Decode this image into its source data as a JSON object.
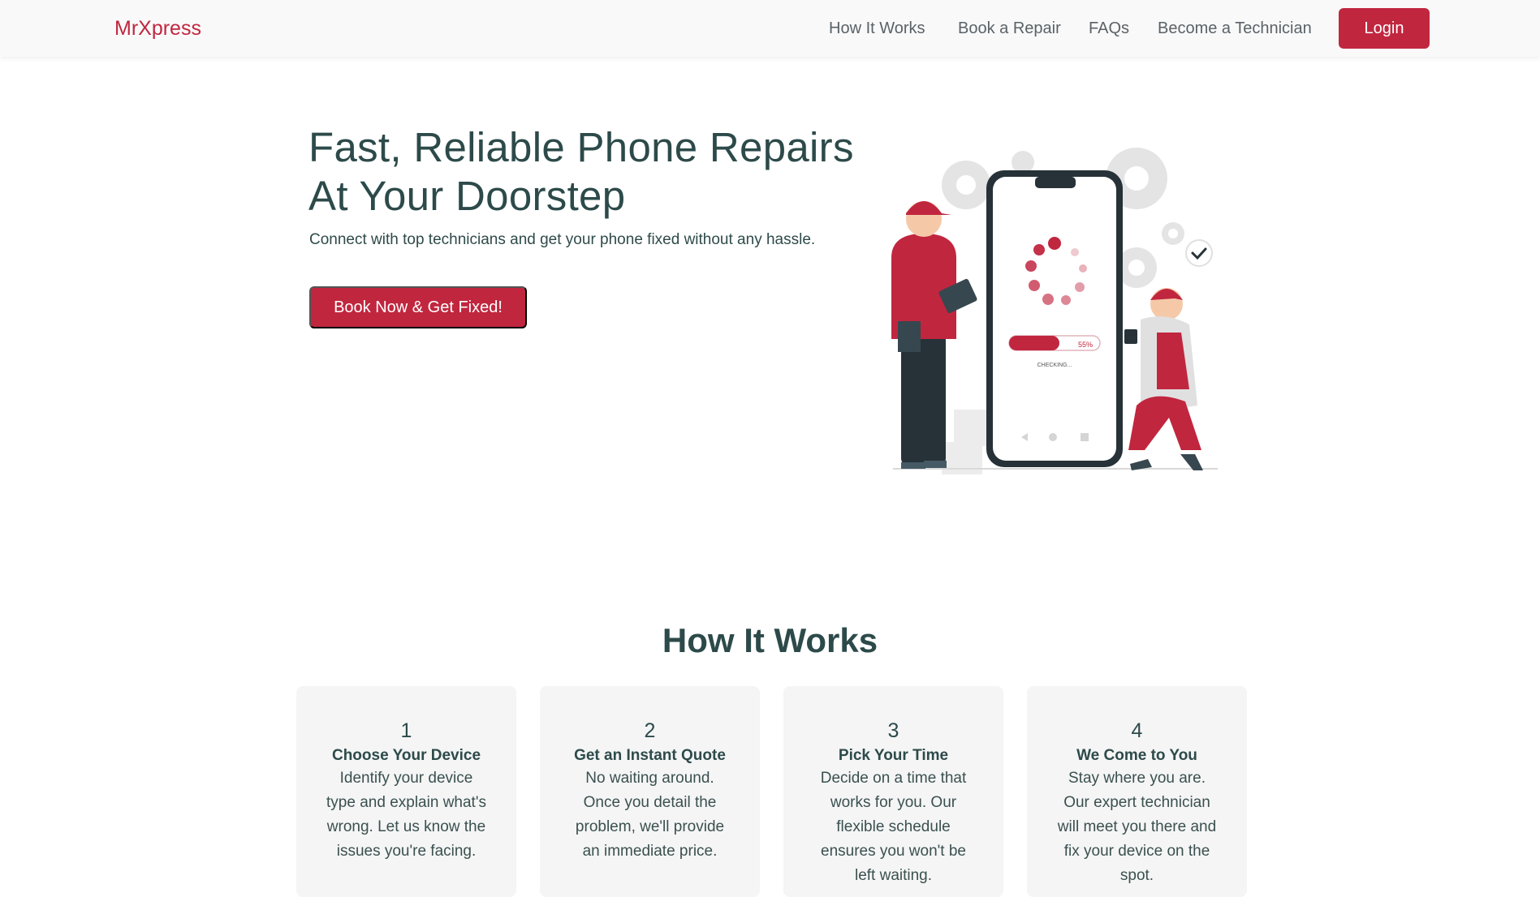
{
  "navbar": {
    "brand": "MrXpress",
    "links": [
      "How It Works",
      "Book a Repair",
      "FAQs",
      "Become a Technician"
    ],
    "login_label": "Login"
  },
  "hero": {
    "title": "Fast, Reliable Phone Repairs At Your Doorstep",
    "subtitle": "Connect with top technicians and get your phone fixed without any hassle.",
    "cta_label": "Book Now & Get Fixed!",
    "illustration": {
      "progress_label": "55%",
      "progress_value": 0.55,
      "status_text": "CHECKING..."
    }
  },
  "how_it_works": {
    "title": "How It Works",
    "steps": [
      {
        "num": "1",
        "title": "Choose Your Device",
        "text": "Identify your device type and explain what's wrong. Let us know the issues you're facing."
      },
      {
        "num": "2",
        "title": "Get an Instant Quote",
        "text": "No waiting around. Once you detail the problem, we'll provide an immediate price."
      },
      {
        "num": "3",
        "title": "Pick Your Time",
        "text": "Decide on a time that works for you. Our flexible schedule ensures you won't be left waiting."
      },
      {
        "num": "4",
        "title": "We Come to You",
        "text": "Stay where you are. Our expert technician will meet you there and fix your device on the spot."
      }
    ]
  },
  "colors": {
    "accent": "#c1263f",
    "heading": "#2d4a4a",
    "card_bg": "#f5f5f5",
    "navbar_bg": "#f9f9f9"
  }
}
